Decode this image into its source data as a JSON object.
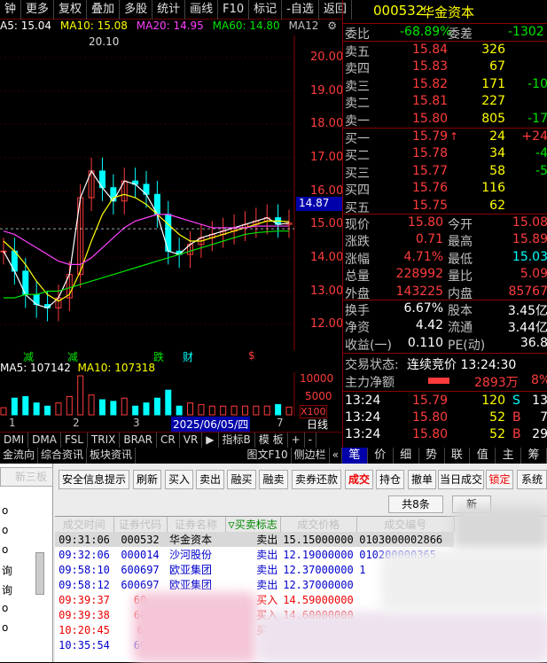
{
  "topbar": {
    "items": [
      "钟",
      "更多",
      "复权",
      "叠加",
      "多股",
      "统计",
      "画线",
      "F10",
      "标记",
      "-自选",
      "返回"
    ]
  },
  "ma": {
    "ma5": "A5: 15.04",
    "ma10": "MA10: 15.08",
    "ma20": "MA20: 14.95",
    "ma60": "MA60: 14.80",
    "ma12": "MA12"
  },
  "chart": {
    "high_label": "20.10",
    "price_ticks": [
      "20.00",
      "19.00",
      "18.00",
      "17.00",
      "16.00",
      "15.00",
      "14.00",
      "13.00",
      "12.00"
    ],
    "current_price": "14.87",
    "events": [
      "减",
      "减",
      "跌",
      "财",
      "$"
    ],
    "vol_ticks": [
      "10000",
      "5000",
      "X100"
    ],
    "date_cursor": "2025/06/05/四",
    "x_labels": [
      "1",
      "2",
      "3",
      "6",
      "7"
    ],
    "rday": "日线"
  },
  "chart_data": {
    "type": "line",
    "title": "",
    "ylim": [
      11.5,
      20.5
    ],
    "series": [
      {
        "name": "MA5",
        "values": [
          14.2,
          13.6,
          12.9,
          12.6,
          12.5,
          12.8,
          13.5,
          15.8,
          16.6,
          16.1,
          15.7,
          16.3,
          16.2,
          15.9,
          15.3,
          14.2,
          14.1,
          14.4,
          14.6,
          14.7,
          14.8,
          14.9,
          15.0,
          15.1,
          15.2,
          15.0,
          15.04
        ]
      },
      {
        "name": "MA10",
        "values": [
          14.5,
          14.2,
          13.8,
          13.3,
          12.9,
          12.7,
          12.9,
          13.6,
          14.5,
          15.3,
          15.8,
          15.9,
          15.8,
          15.6,
          15.3,
          15.0,
          14.7,
          14.5,
          14.5,
          14.6,
          14.7,
          14.8,
          14.9,
          15.0,
          15.1,
          15.1,
          15.08
        ]
      },
      {
        "name": "MA20",
        "values": [
          14.8,
          14.7,
          14.5,
          14.3,
          14.1,
          13.9,
          13.8,
          13.8,
          14.0,
          14.3,
          14.6,
          14.9,
          15.1,
          15.2,
          15.3,
          15.3,
          15.2,
          15.1,
          15.0,
          14.9,
          14.9,
          14.9,
          14.9,
          14.95,
          14.95,
          14.95,
          14.95
        ]
      },
      {
        "name": "MA60",
        "values": [
          12.8,
          12.8,
          12.9,
          12.9,
          13.0,
          13.0,
          13.1,
          13.2,
          13.3,
          13.4,
          13.5,
          13.6,
          13.7,
          13.8,
          13.9,
          14.0,
          14.1,
          14.2,
          14.3,
          14.4,
          14.5,
          14.6,
          14.7,
          14.75,
          14.78,
          14.8,
          14.8
        ]
      }
    ],
    "volume": {
      "ma5": 107142,
      "ma10": 107318
    }
  },
  "vol": {
    "ma5": "MA5: 107142",
    "ma10": "MA10: 107318"
  },
  "subtabs": [
    "DMI",
    "DMA",
    "FSL",
    "TRIX",
    "BRAR",
    "CR",
    "VR",
    "▶",
    "指标B",
    "模 板",
    "+",
    "-"
  ],
  "bottombar": [
    "金流向",
    "综合资讯",
    "板块资讯",
    "图文F10",
    "侧边栏",
    "«"
  ],
  "stock": {
    "code": "000532",
    "name": "华金资本"
  },
  "weibi": {
    "label": "委比",
    "value": "-68.89%",
    "label2": "委差",
    "value2": "-1302"
  },
  "asks": [
    {
      "label": "卖五",
      "price": "15.84",
      "vol": "326",
      "chg": ""
    },
    {
      "label": "卖四",
      "price": "15.83",
      "vol": "67",
      "chg": ""
    },
    {
      "label": "卖三",
      "price": "15.82",
      "vol": "171",
      "chg": "-10"
    },
    {
      "label": "卖二",
      "price": "15.81",
      "vol": "227",
      "chg": ""
    },
    {
      "label": "卖一",
      "price": "15.80",
      "vol": "805",
      "chg": "-17"
    }
  ],
  "bids": [
    {
      "label": "买一",
      "price": "15.79",
      "vol": "24",
      "chg": "+24"
    },
    {
      "label": "买二",
      "price": "15.78",
      "vol": "34",
      "chg": "-4"
    },
    {
      "label": "买三",
      "price": "15.77",
      "vol": "58",
      "chg": "-5"
    },
    {
      "label": "买四",
      "price": "15.76",
      "vol": "116",
      "chg": ""
    },
    {
      "label": "买五",
      "price": "15.75",
      "vol": "62",
      "chg": ""
    }
  ],
  "quote": [
    {
      "l1": "现价",
      "v1": "15.80",
      "l2": "今开",
      "v2": "15.08"
    },
    {
      "l1": "涨跌",
      "v1": "0.71",
      "l2": "最高",
      "v2": "15.89"
    },
    {
      "l1": "涨幅",
      "v1": "4.71%",
      "l2": "最低",
      "v2": "15.03"
    },
    {
      "l1": "总量",
      "v1": "228992",
      "l2": "量比",
      "v2": "5.09"
    },
    {
      "l1": "外盘",
      "v1": "143225",
      "l2": "内盘",
      "v2": "85767"
    }
  ],
  "quote2": [
    {
      "l1": "换手",
      "v1": "6.67%",
      "l2": "股本",
      "v2": "3.45亿"
    },
    {
      "l1": "净资",
      "v1": "4.42",
      "l2": "流通",
      "v2": "3.44亿"
    },
    {
      "l1": "收益(一)",
      "v1": "0.110",
      "l2": "PE(动)",
      "v2": "36.8"
    }
  ],
  "status": {
    "label": "交易状态:",
    "value": "连续竞价 13:24:30"
  },
  "netflow": {
    "label": "主力净额",
    "value": "2893万",
    "pct": "8%"
  },
  "ticks": [
    {
      "time": "13:24",
      "price": "15.79",
      "vol": "120",
      "side": "S",
      "num": "13"
    },
    {
      "time": "13:24",
      "price": "15.80",
      "vol": "52",
      "side": "B",
      "num": "7"
    },
    {
      "time": "13:24",
      "price": "15.80",
      "vol": "52",
      "side": "B",
      "num": "29"
    }
  ],
  "rptabs": [
    "笔",
    "价",
    "细",
    "势",
    "联",
    "值",
    "主",
    "筹"
  ],
  "trade": {
    "left_top": "新三板",
    "buttons": [
      "安全信息提示",
      "刷新",
      "买入",
      "卖出",
      "融买",
      "融卖",
      "卖券还款",
      "成交",
      "持仓",
      "撤单",
      "当日成交",
      "锁定",
      "系统"
    ],
    "count": "共8条",
    "new_btn": "新",
    "headers": [
      "成交时间",
      "证券代码",
      "证券名称",
      "▽买卖标志",
      "成交价格",
      "成交编号"
    ],
    "rows": [
      {
        "time": "09:31:06",
        "code": "000532",
        "name": "华金资本",
        "side": "卖出",
        "price": "15.15000000",
        "id": "0103000002866"
      },
      {
        "time": "09:32:06",
        "code": "000014",
        "name": "沙河股份",
        "side": "卖出",
        "price": "12.19000000",
        "id": "010200000365"
      },
      {
        "time": "09:58:10",
        "code": "600697",
        "name": "欧亚集团",
        "side": "卖出",
        "price": "12.37000000",
        "id": "1"
      },
      {
        "time": "09:58:12",
        "code": "600697",
        "name": "欧亚集团",
        "side": "卖出",
        "price": "12.37000000",
        "id": ""
      },
      {
        "time": "09:39:37",
        "code": "60",
        "name": "",
        "side": "买入",
        "price": "14.59000000",
        "id": ""
      },
      {
        "time": "09:39:38",
        "code": "60",
        "name": "",
        "side": "买入",
        "price": "14.60000000",
        "id": ""
      },
      {
        "time": "10:20:45",
        "code": "6",
        "name": "",
        "side": "买入",
        "price": "1",
        "id": ""
      },
      {
        "time": "10:35:54",
        "code": "60",
        "name": "",
        "side": "",
        "price": "",
        "id": ""
      }
    ],
    "left_items": [
      "o",
      "o",
      "o",
      "询",
      "询",
      "o",
      "o"
    ]
  }
}
